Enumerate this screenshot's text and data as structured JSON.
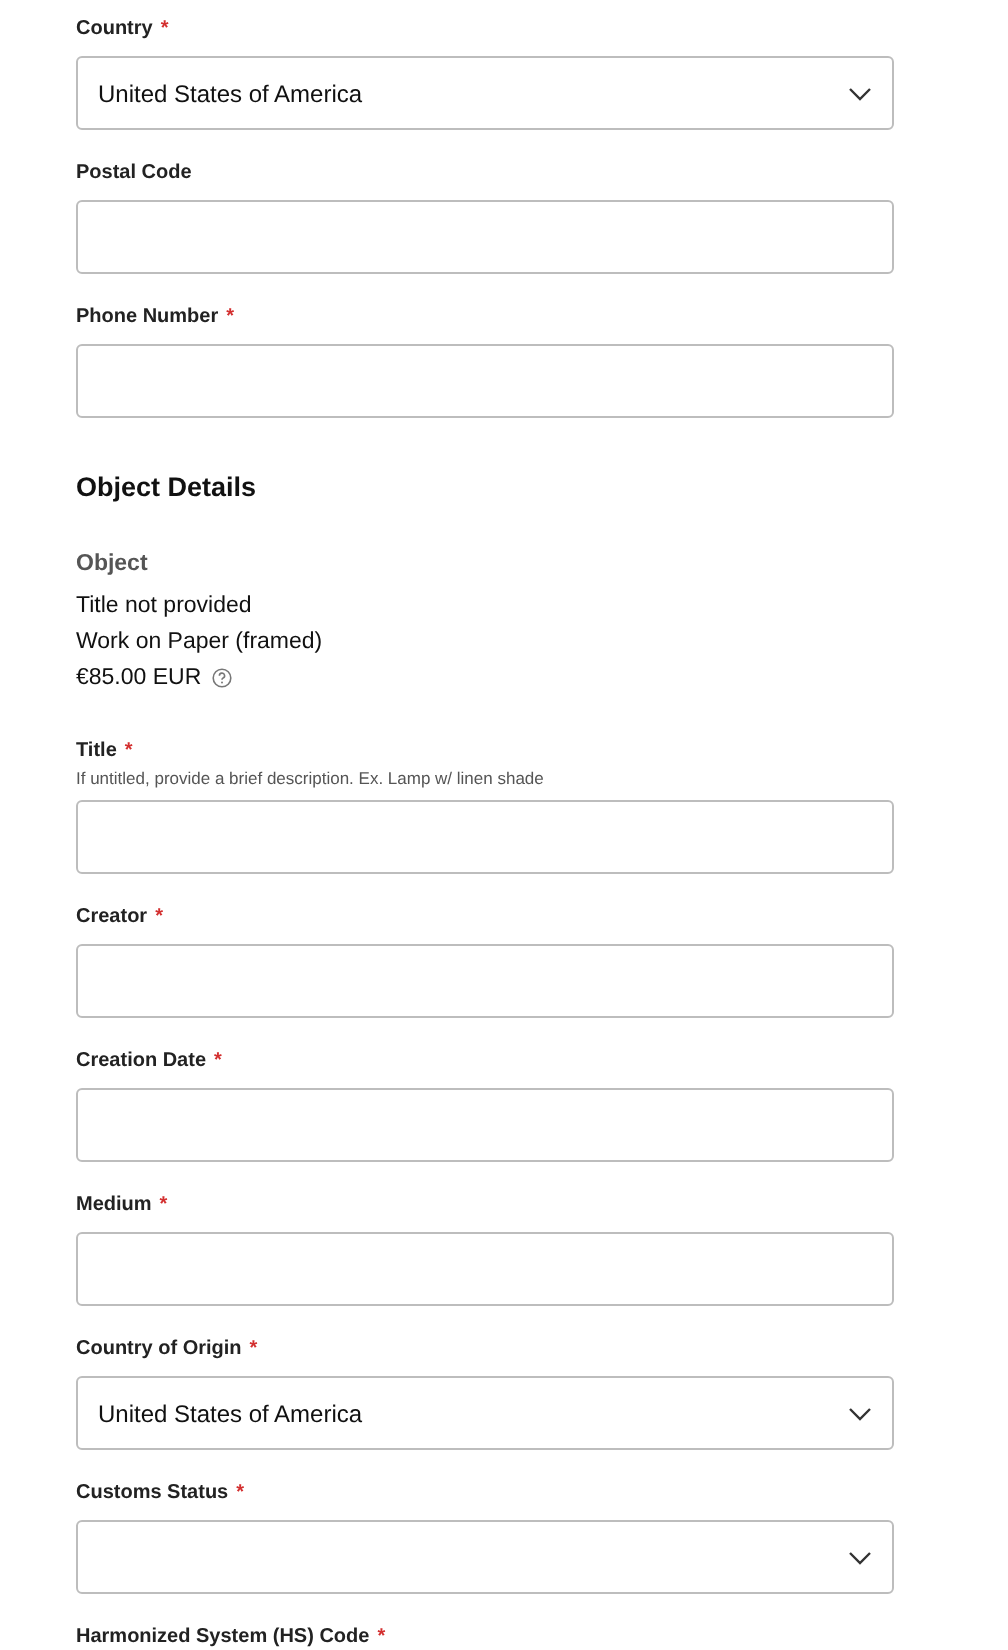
{
  "address_fields": [
    {
      "kind": "select",
      "label": "Country",
      "required_mark": "*",
      "value": "United States of America"
    },
    {
      "kind": "text",
      "label": "Postal Code"
    },
    {
      "kind": "text",
      "label": "Phone Number",
      "required_mark": "*"
    }
  ],
  "object_details": {
    "heading": "Object Details",
    "summary_label": "Object",
    "lines": [
      "Title not provided",
      "Work on Paper (framed)"
    ],
    "price": "€85.00 EUR"
  },
  "object_fields": [
    {
      "kind": "text",
      "label": "Title",
      "required_mark": "*",
      "hint": "If untitled, provide a brief description. Ex. Lamp w/ linen shade"
    },
    {
      "kind": "text",
      "label": "Creator",
      "required_mark": "*"
    },
    {
      "kind": "text",
      "label": "Creation Date",
      "required_mark": "*"
    },
    {
      "kind": "text",
      "label": "Medium",
      "required_mark": "*"
    },
    {
      "kind": "select",
      "label": "Country of Origin",
      "required_mark": "*",
      "value": "United States of America"
    },
    {
      "kind": "select",
      "label": "Customs Status",
      "required_mark": "*"
    },
    {
      "kind": "cut",
      "label": "Harmonized System (HS) Code",
      "required_mark": "*"
    }
  ]
}
